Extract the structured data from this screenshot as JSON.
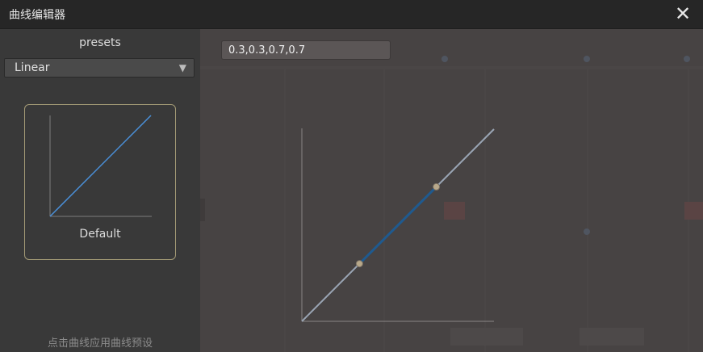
{
  "window": {
    "title": "曲线编辑器"
  },
  "presets": {
    "title": "presets",
    "selected": "Linear",
    "cards": [
      {
        "name": "Default"
      }
    ],
    "hint": "点击曲线应用曲线预设"
  },
  "editor": {
    "bezier_value": "0.3,0.3,0.7,0.7"
  },
  "chart_data": {
    "type": "line",
    "x": [
      0,
      1
    ],
    "y": [
      0,
      1
    ],
    "control_points": [
      [
        0.3,
        0.3
      ],
      [
        0.7,
        0.7
      ]
    ],
    "colors": {
      "curve": "#9aa5b4",
      "segment": "#1f5a8f",
      "handle": "#b8a88a"
    }
  },
  "colors": {
    "accent": "#4a90d9",
    "card_border": "#a39a76"
  }
}
